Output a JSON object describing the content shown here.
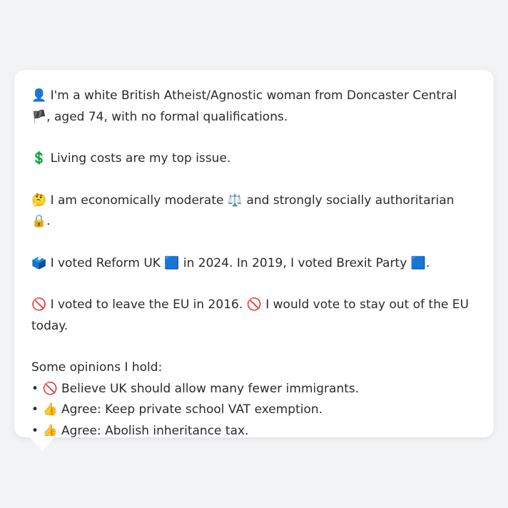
{
  "card": {
    "identity": {
      "icon": "👤",
      "text_a": "I'm a white British Atheist/Agnostic woman from Doncaster Central ",
      "flag": "🏴",
      "text_b": ", aged 74, with no formal qualifications."
    },
    "issue": {
      "icon": "💲",
      "text": "Living costs are my top issue."
    },
    "ideology": {
      "icon": "🤔",
      "text_a": "I am economically moderate ",
      "scale_icon": "⚖️",
      "text_b": " and strongly socially authoritarian ",
      "lock_icon": "🔒",
      "text_c": "."
    },
    "vote": {
      "icon": "🗳️",
      "text_a": "I voted Reform UK ",
      "party_icon_a": "🟦",
      "text_b": " in 2024. In 2019, I voted Brexit Party ",
      "party_icon_b": "🟦",
      "text_c": "."
    },
    "eu": {
      "icon_a": "🚫",
      "text_a": "I voted to leave the EU in 2016. ",
      "icon_b": "🚫",
      "text_b": "I would vote to stay out of the EU today."
    },
    "opinions": {
      "heading": "Some opinions I hold:",
      "items": [
        {
          "bullet": "•",
          "icon": "🚫",
          "text": "Believe UK should allow many fewer immigrants."
        },
        {
          "bullet": "•",
          "icon": "👍",
          "text": "Agree: Keep private school VAT exemption."
        },
        {
          "bullet": "•",
          "icon": "👍",
          "text": "Agree: Abolish inheritance tax."
        }
      ]
    }
  }
}
